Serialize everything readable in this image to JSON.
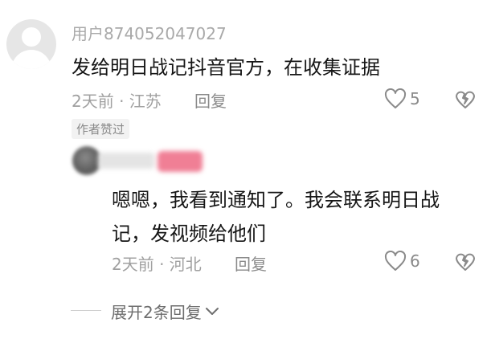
{
  "comment": {
    "username": "用户874052047027",
    "text": "发给明日战记抖音官方，在收集证据",
    "meta": "2天前 · 江苏",
    "reply_label": "回复",
    "likes": "5",
    "author_badge": "作者赞过"
  },
  "reply": {
    "text_line1": "嗯嗯，我看到通知了。我会联系明日战",
    "text_line2": "记，发视频给他们",
    "meta": "2天前 · 河北",
    "reply_label": "回复",
    "likes": "6"
  },
  "expand": {
    "label": "展开2条回复"
  },
  "colors": {
    "text_primary": "#161616",
    "text_secondary": "#a0a0a0",
    "username": "#a9a9a9",
    "redacted_pink": "#f07f95"
  }
}
